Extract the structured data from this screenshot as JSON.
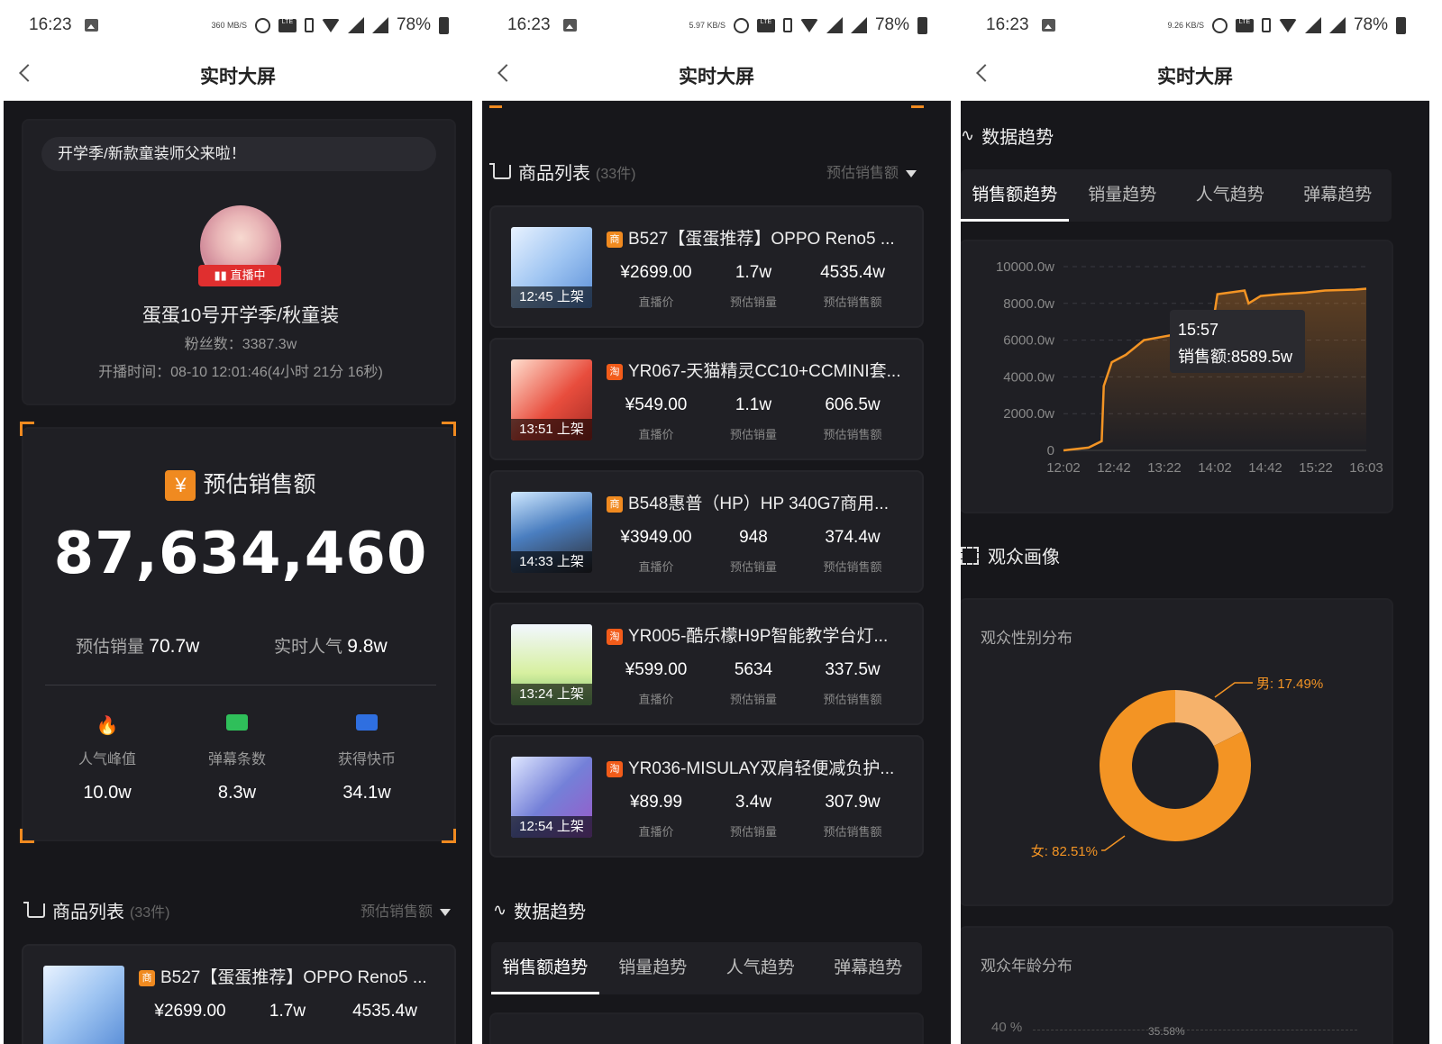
{
  "status": [
    {
      "time": "16:23",
      "speed": "360 MB/S",
      "battery": "78%"
    },
    {
      "time": "16:23",
      "speed": "5.97 KB/S",
      "battery": "78%"
    },
    {
      "time": "16:23",
      "speed": "9.26 KB/S",
      "battery": "78%"
    }
  ],
  "nav": {
    "title": "实时大屏"
  },
  "anchor": {
    "banner": "开学季/新款童装师父来啦！",
    "live_badge": "直播中",
    "name": "蛋蛋10号开学季/秋童装",
    "fans": "粉丝数：3387.3w",
    "start_time": "开播时间：08-10 12:01:46(4小时 21分 16秒)"
  },
  "sales": {
    "title": "预估销售额",
    "total": "87,634,460",
    "est_volume_label": "预估销量",
    "est_volume": "70.7w",
    "realtime_pop_label": "实时人气",
    "realtime_pop": "9.8w",
    "stats": [
      {
        "label": "人气峰值",
        "value": "10.0w",
        "icon": "fire-icon"
      },
      {
        "label": "弹幕条数",
        "value": "8.3w",
        "icon": "comment-icon"
      },
      {
        "label": "获得快币",
        "value": "34.1w",
        "icon": "coin-icon"
      }
    ]
  },
  "product_list": {
    "title": "商品列表",
    "count": "(33件)",
    "sort": "预估销售额",
    "col_labels": [
      "直播价",
      "预估销量",
      "预估销售额"
    ],
    "items": [
      {
        "title": "B527【蛋蛋推荐】OPPO Reno5 ...",
        "shelf": "12:45 上架",
        "price": "¥2699.00",
        "volume": "1.7w",
        "sales": "4535.4w",
        "platform": "商"
      },
      {
        "title": "YR067-天猫精灵CC10+CCMINI套...",
        "shelf": "13:51 上架",
        "price": "¥549.00",
        "volume": "1.1w",
        "sales": "606.5w",
        "platform": "淘"
      },
      {
        "title": "B548惠普（HP）HP 340G7商用...",
        "shelf": "14:33 上架",
        "price": "¥3949.00",
        "volume": "948",
        "sales": "374.4w",
        "platform": "商"
      },
      {
        "title": "YR005-酷乐檬H9P智能教学台灯...",
        "shelf": "13:24 上架",
        "price": "¥599.00",
        "volume": "5634",
        "sales": "337.5w",
        "platform": "淘"
      },
      {
        "title": "YR036-MISULAY双肩轻便减负护...",
        "shelf": "12:54 上架",
        "price": "¥89.99",
        "volume": "3.4w",
        "sales": "307.9w",
        "platform": "淘"
      }
    ]
  },
  "trend": {
    "title": "数据趋势",
    "tabs": [
      "销售额趋势",
      "销量趋势",
      "人气趋势",
      "弹幕趋势"
    ],
    "tooltip_time": "15:57",
    "tooltip_value": "销售额:8589.5w"
  },
  "audience": {
    "title": "观众画像",
    "gender_title": "观众性别分布",
    "male_label": "男: 17.49%",
    "female_label": "女: 82.51%",
    "age_title": "观众年龄分布",
    "age_tick": "40 %",
    "age_value": "35.58%"
  },
  "chart_data": [
    {
      "type": "line",
      "title": "销售额趋势",
      "x": [
        "12:02",
        "12:42",
        "13:22",
        "14:02",
        "14:42",
        "15:22",
        "16:03"
      ],
      "yticks": [
        "0",
        "2000.0w",
        "4000.0w",
        "6000.0w",
        "8000.0w",
        "10000.0w"
      ],
      "ylim": [
        0,
        10000
      ],
      "series": [
        {
          "values": [
            [
              0,
              0
            ],
            [
              25,
              150
            ],
            [
              38,
              500
            ],
            [
              40,
              3500
            ],
            [
              48,
              4800
            ],
            [
              62,
              5200
            ],
            [
              80,
              6000
            ],
            [
              110,
              6300
            ],
            [
              130,
              7200
            ],
            [
              150,
              7400
            ],
            [
              153,
              8500
            ],
            [
              180,
              8700
            ],
            [
              184,
              8000
            ],
            [
              196,
              8400
            ],
            [
              215,
              8500
            ],
            [
              241,
              8589.5
            ],
            [
              260,
              8700
            ],
            [
              290,
              8750
            ],
            [
              301,
              8800
            ]
          ]
        }
      ],
      "grid": true
    },
    {
      "type": "pie",
      "title": "观众性别分布",
      "categories": [
        "男",
        "女"
      ],
      "values": [
        17.49,
        82.51
      ]
    }
  ],
  "colors": {
    "accent": "#f08a20",
    "bg": "#17171b",
    "card": "#1f1f24",
    "live": "#e02f2f",
    "male": "#f6b26b",
    "female": "#f39424"
  }
}
